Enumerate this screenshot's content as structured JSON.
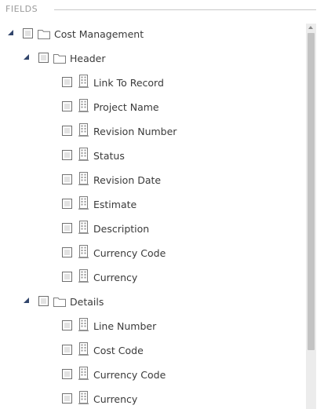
{
  "header": {
    "title": "FIELDS"
  },
  "tree": [
    {
      "label": "Cost Management",
      "level": 0,
      "type": "folder",
      "expanded": true
    },
    {
      "label": "Header",
      "level": 1,
      "type": "folder",
      "expanded": true
    },
    {
      "label": "Link To Record",
      "level": 2,
      "type": "field"
    },
    {
      "label": "Project Name",
      "level": 2,
      "type": "field"
    },
    {
      "label": "Revision Number",
      "level": 2,
      "type": "field"
    },
    {
      "label": "Status",
      "level": 2,
      "type": "field"
    },
    {
      "label": "Revision Date",
      "level": 2,
      "type": "field"
    },
    {
      "label": "Estimate",
      "level": 2,
      "type": "field"
    },
    {
      "label": "Description",
      "level": 2,
      "type": "field"
    },
    {
      "label": "Currency Code",
      "level": 2,
      "type": "field"
    },
    {
      "label": "Currency",
      "level": 2,
      "type": "field"
    },
    {
      "label": "Details",
      "level": 1,
      "type": "folder",
      "expanded": true
    },
    {
      "label": "Line Number",
      "level": 2,
      "type": "field"
    },
    {
      "label": "Cost Code",
      "level": 2,
      "type": "field"
    },
    {
      "label": "Currency Code",
      "level": 2,
      "type": "field"
    },
    {
      "label": "Currency",
      "level": 2,
      "type": "field"
    }
  ],
  "colors": {
    "toggle": "#31456b",
    "header_text": "#9a9a9a",
    "label_text": "#3a3a3a"
  }
}
